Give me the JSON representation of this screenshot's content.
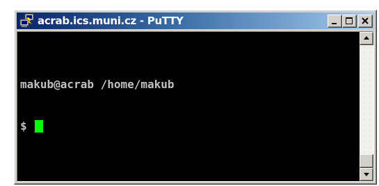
{
  "window": {
    "title": "acrab.ics.muni.cz - PuTTY",
    "icon": "putty-app-icon",
    "caption_buttons": [
      "minimize",
      "maximize",
      "close"
    ]
  },
  "terminal": {
    "lines": [
      "makub@acrab /home/makub",
      "$ "
    ],
    "cursor_color": "#00ff00",
    "text_color": "#c0c0c0",
    "background_color": "#000000"
  },
  "scrollbar": {
    "up_icon": "scroll-up-arrow-icon",
    "down_icon": "scroll-down-arrow-icon"
  },
  "colors": {
    "titlebar_start": "#0a246a",
    "titlebar_end": "#a6caf0",
    "chrome": "#d4d0c8"
  }
}
